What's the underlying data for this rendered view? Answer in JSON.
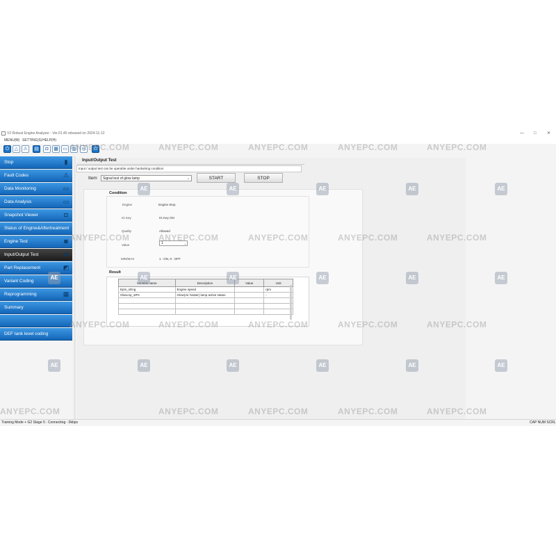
{
  "window": {
    "title": "V2 Robust Engine Analyzer - Ver.01.40 released on 2024-11-12",
    "min": "—",
    "max": "□",
    "close": "✕"
  },
  "menu": [
    "MENU(M)",
    "SETTING(S)",
    "HELP(H)"
  ],
  "toolbar_icons": [
    "power-icon",
    "alert-icon",
    "warning-icon",
    "document-icon",
    "camera-icon",
    "grid-icon",
    "plug-icon",
    "print-icon",
    "info-icon",
    "power-off-icon"
  ],
  "sidebar": {
    "items": [
      {
        "label": "Stop",
        "icon": "battery-icon",
        "glyph": "▮",
        "active": false
      },
      {
        "label": "Fault Codes",
        "icon": "warning-icon",
        "glyph": "⚠",
        "active": false
      },
      {
        "label": "Data Monitoring",
        "icon": "monitor-icon",
        "glyph": "▭",
        "active": false
      },
      {
        "label": "Data Analysis",
        "icon": "monitor-icon",
        "glyph": "▭",
        "active": false
      },
      {
        "label": "Snapshot Viewer",
        "icon": "camera-icon",
        "glyph": "◘",
        "active": false
      },
      {
        "label": "Status of Engine&Aftertreatment",
        "icon": "",
        "glyph": "",
        "active": false
      },
      {
        "label": "Engine Test",
        "icon": "car-icon",
        "glyph": "◙",
        "active": false
      },
      {
        "label": "Input/Output Test",
        "icon": "swap-icon",
        "glyph": "⇄",
        "active": true
      },
      {
        "label": "Part Replacement",
        "icon": "part-icon",
        "glyph": "◩",
        "active": false
      },
      {
        "label": "Variant Coding",
        "icon": "",
        "glyph": "",
        "active": false
      },
      {
        "label": "Reprogramming",
        "icon": "chip-icon",
        "glyph": "▦",
        "active": false
      },
      {
        "label": "Summary",
        "icon": "",
        "glyph": "",
        "active": false
      },
      {
        "label": "",
        "icon": "",
        "glyph": "",
        "active": false
      },
      {
        "label": "DEF tank level coding",
        "icon": "",
        "glyph": "",
        "active": false
      }
    ]
  },
  "content": {
    "header": "Input/Output Test",
    "info": "Input / output test can be operable under hardwiring condition",
    "item_label": "Item",
    "item_value": "Signal test of glow lamp",
    "start_label": "START",
    "stop_label": "STOP",
    "condition": {
      "title": "Condition",
      "rows": [
        {
          "key": "Engine",
          "value": "Engine Stop"
        },
        {
          "key": "IG Key",
          "value": "IG Key ON"
        },
        {
          "key": "Quality",
          "value": "Allowed"
        }
      ],
      "value_label": "Value",
      "value_selected": "1",
      "minmax_label": "MIN/MAX",
      "minmax_value": "1 : ON, 0 : OFF"
    },
    "result": {
      "title": "Result",
      "columns": [
        "Variable name",
        "Description",
        "Value",
        "Unit"
      ],
      "rows": [
        [
          "Epm_nEng",
          "Engine speed",
          "",
          "rpm"
        ],
        [
          "GlwLmp_stPs",
          "Glow(Air heater) lamp active status",
          "",
          "-"
        ],
        [
          "",
          "",
          "",
          ""
        ],
        [
          "",
          "",
          "",
          ""
        ],
        [
          "",
          "",
          "",
          ""
        ]
      ]
    }
  },
  "status": {
    "left": "Training Mode + G2 Stage 5 : Connecting - 0kbps",
    "right": "CAP  NUM  SCRL"
  },
  "watermark": {
    "text": "ANYEPC.COM",
    "badge": "AE"
  }
}
